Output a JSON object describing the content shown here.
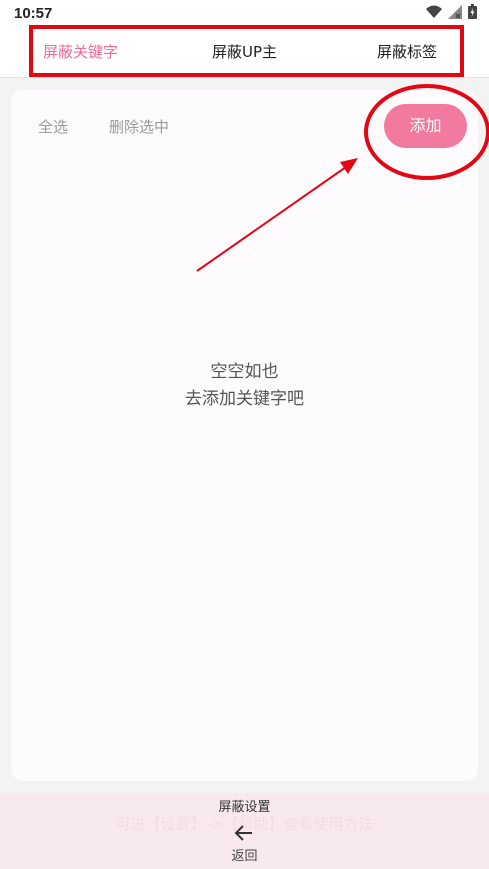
{
  "status": {
    "time": "10:57",
    "icons": [
      "wifi-icon",
      "signal-icon",
      "battery-icon"
    ]
  },
  "tabs": [
    {
      "label": "屏蔽关键字",
      "active": true
    },
    {
      "label": "屏蔽UP主",
      "active": false
    },
    {
      "label": "屏蔽标签",
      "active": false
    }
  ],
  "toolbar": {
    "select_all": "全选",
    "delete_selected": "删除选中",
    "add": "添加"
  },
  "empty_state": {
    "line1": "空空如也",
    "line2": "去添加关键字吧"
  },
  "footer": {
    "hint": "可进【设置】->【帮助】查看使用方法",
    "title": "屏蔽设置",
    "back_label": "返回"
  },
  "colors": {
    "accent": "#f06b96",
    "add_button": "#f37a9f",
    "annotation": "#e30613"
  }
}
